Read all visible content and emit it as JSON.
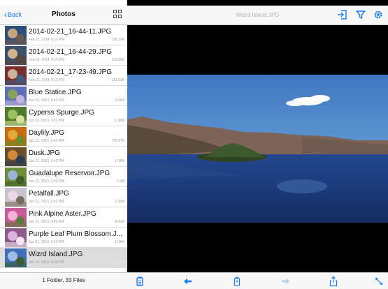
{
  "sidebar": {
    "back_label": "Back",
    "title": "Photos",
    "footer": "1 Folder, 33 Files",
    "files": [
      {
        "name": "2014-02-21_16-44-11.JPG",
        "date": "Feb 21, 2014, 6:15 PM",
        "size": "118.33K"
      },
      {
        "name": "2014-02-21_16-44-29.JPG",
        "date": "Feb 21, 2014, 6:15 PM",
        "size": "133.89K"
      },
      {
        "name": "2014-02-21_17-23-49.JPG",
        "date": "Feb 21, 2014, 6:15 PM",
        "size": "212.91K"
      },
      {
        "name": "Blue Statice.JPG",
        "date": "Jun 21, 2013, 3:43 PM",
        "size": "2.02M"
      },
      {
        "name": "Cyperss Spurge.JPG",
        "date": "Jun 21, 2013, 3:42 PM",
        "size": "1.38M"
      },
      {
        "name": "Daylily.JPG",
        "date": "Jun 21, 2013, 3:43 PM",
        "size": "776.97K"
      },
      {
        "name": "Dusk.JPG",
        "date": "Jun 21, 2013, 3:42 PM",
        "size": "1.64M"
      },
      {
        "name": "Guadalupe Reservoir.JPG",
        "date": "Jun 21, 2013, 3:42 PM",
        "size": "1.9M"
      },
      {
        "name": "Petalfall.JPG",
        "date": "Jun 21, 2013, 3:42 PM",
        "size": "1.39M"
      },
      {
        "name": "Pink Alpine Aster.JPG",
        "date": "Jun 21, 2013, 3:43 PM",
        "size": "4.05M"
      },
      {
        "name": "Purple Leaf Plum Blossom.J...",
        "date": "Jun 21, 2013, 3:43 PM",
        "size": "1.04M"
      },
      {
        "name": "Wizrd Island.JPG",
        "date": "Jun 21, 2013, 3:43 PM",
        "size": "1.41M",
        "selected": true
      }
    ]
  },
  "main": {
    "title": "Wizrd Island.JPG",
    "header_icons": [
      "open-in-icon",
      "filter-icon",
      "gear-icon"
    ],
    "footer_icons": [
      "clipboard-icon",
      "arrow-left-icon",
      "copy-icon",
      "arrow-right-icon",
      "share-icon",
      "expand-icon"
    ]
  },
  "colors": {
    "accent": "#1a7cf5",
    "selected_row": "#dcdcdc",
    "bar_bg": "#f7f7f7"
  }
}
